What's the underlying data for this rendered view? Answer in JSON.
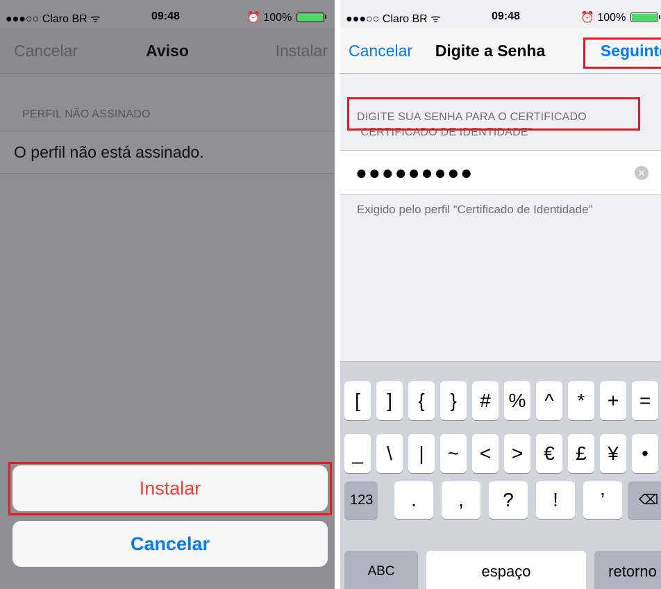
{
  "status_left": {
    "carrier": "●●●○○ Claro BR ᯤ",
    "time": "09:48",
    "battery": "100%",
    "battery_level": 1.0
  },
  "status_right": {
    "carrier": "●●●○○ Claro BR ᯤ",
    "time": "09:48",
    "battery": "100%",
    "battery_level": 1.0
  },
  "left": {
    "nav": {
      "cancel": "Cancelar",
      "title": "Aviso",
      "install": "Instalar"
    },
    "section_header": "PERFIL NÃO ASSINADO",
    "cell_text": "O perfil não está assinado.",
    "sheet": {
      "install": "Instalar",
      "cancel": "Cancelar"
    }
  },
  "right": {
    "nav": {
      "cancel": "Cancelar",
      "title": "Digite a Senha",
      "next": "Seguinte"
    },
    "section_header_line1": "DIGITE SUA SENHA PARA O CERTIFICADO",
    "section_header_line2": "“CERTIFICADO DE IDENTIDADE”",
    "password_value": "●●●●●●●●●",
    "footer_note": "Exigido pelo perfil “Certificado de Identidade”",
    "keyboard": {
      "row1": [
        "[",
        "]",
        "{",
        "}",
        "#",
        "%",
        "^",
        "*",
        "+",
        "="
      ],
      "row2": [
        "_",
        "\\",
        "|",
        "~",
        "<",
        ">",
        "€",
        "£",
        "¥",
        "•"
      ],
      "row3_mode": "123",
      "row3": [
        ".",
        ",",
        "?",
        "!",
        "’"
      ],
      "row4_abc": "ABC",
      "row4_space": "espaço",
      "row4_return": "retorno"
    }
  },
  "colors": {
    "accent": "#007aff",
    "destructive": "#ff3b30",
    "highlight": "#e31b23",
    "battery_fill": "#4cd964"
  }
}
